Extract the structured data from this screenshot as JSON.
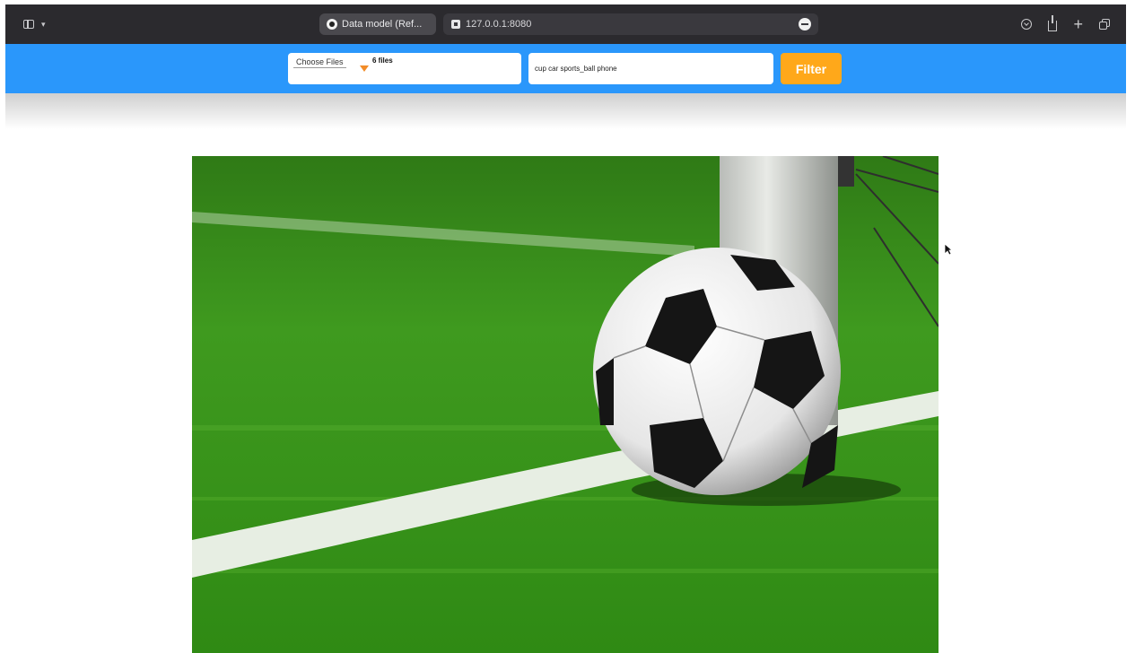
{
  "browser": {
    "tab_title": "Data model (Ref...",
    "url": "127.0.0.1:8080",
    "icons": [
      "sidebar-icon",
      "chevron-down-icon",
      "tab-favicon-icon",
      "site-icon",
      "minus-circle-icon",
      "download-icon",
      "share-icon",
      "plus-icon",
      "tabs-overview-icon"
    ]
  },
  "toolbar": {
    "choose_files_label": "Choose Files",
    "files_selected": "6 files",
    "tags_value": "cup car sports_ball phone",
    "filter_label": "Filter",
    "colors": {
      "bar": "#2a97fb",
      "filter_button": "#ffa81a"
    }
  },
  "main": {
    "image": {
      "subject": "soccer ball on artificial turf next to goal post",
      "icon": "soccer-ball-photo"
    }
  }
}
